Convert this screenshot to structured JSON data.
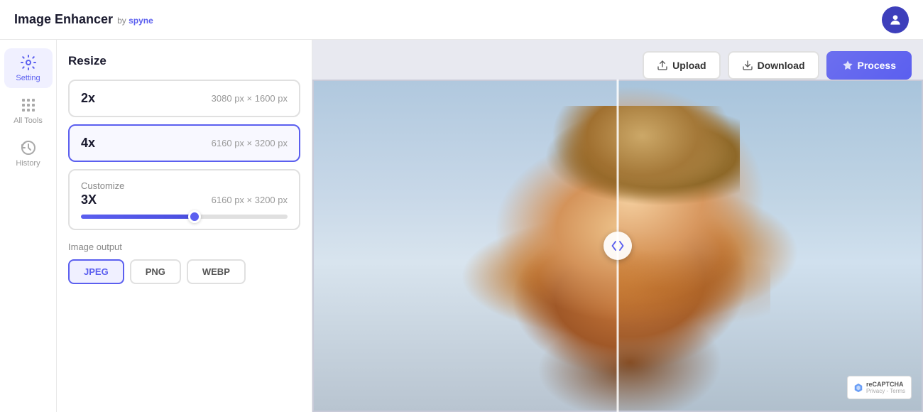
{
  "app": {
    "title": "Image Enhancer",
    "subtitle": "by spyne",
    "subtitle_brand": "spyne"
  },
  "header": {
    "upload_label": "Upload",
    "download_label": "Download",
    "process_label": "Process"
  },
  "sidebar": {
    "items": [
      {
        "id": "setting",
        "label": "Setting",
        "active": true
      },
      {
        "id": "all-tools",
        "label": "All Tools",
        "active": false
      },
      {
        "id": "history",
        "label": "History",
        "active": false
      }
    ]
  },
  "panel": {
    "title": "Resize",
    "options": [
      {
        "id": "2x",
        "label": "2x",
        "dims": "3080 px × 1600 px",
        "selected": false
      },
      {
        "id": "4x",
        "label": "4x",
        "dims": "6160 px × 3200 px",
        "selected": true
      }
    ],
    "customize": {
      "title": "Customize",
      "scale": "3X",
      "dims": "6160 px × 3200 px",
      "slider_percent": 55
    },
    "output_label": "Image output",
    "output_formats": [
      {
        "id": "jpeg",
        "label": "JPEG",
        "active": true
      },
      {
        "id": "png",
        "label": "PNG",
        "active": false
      },
      {
        "id": "webp",
        "label": "WEBP",
        "active": false
      }
    ]
  },
  "recaptcha": {
    "text": "reCAPTCHA",
    "subtext": "Privacy - Terms"
  }
}
